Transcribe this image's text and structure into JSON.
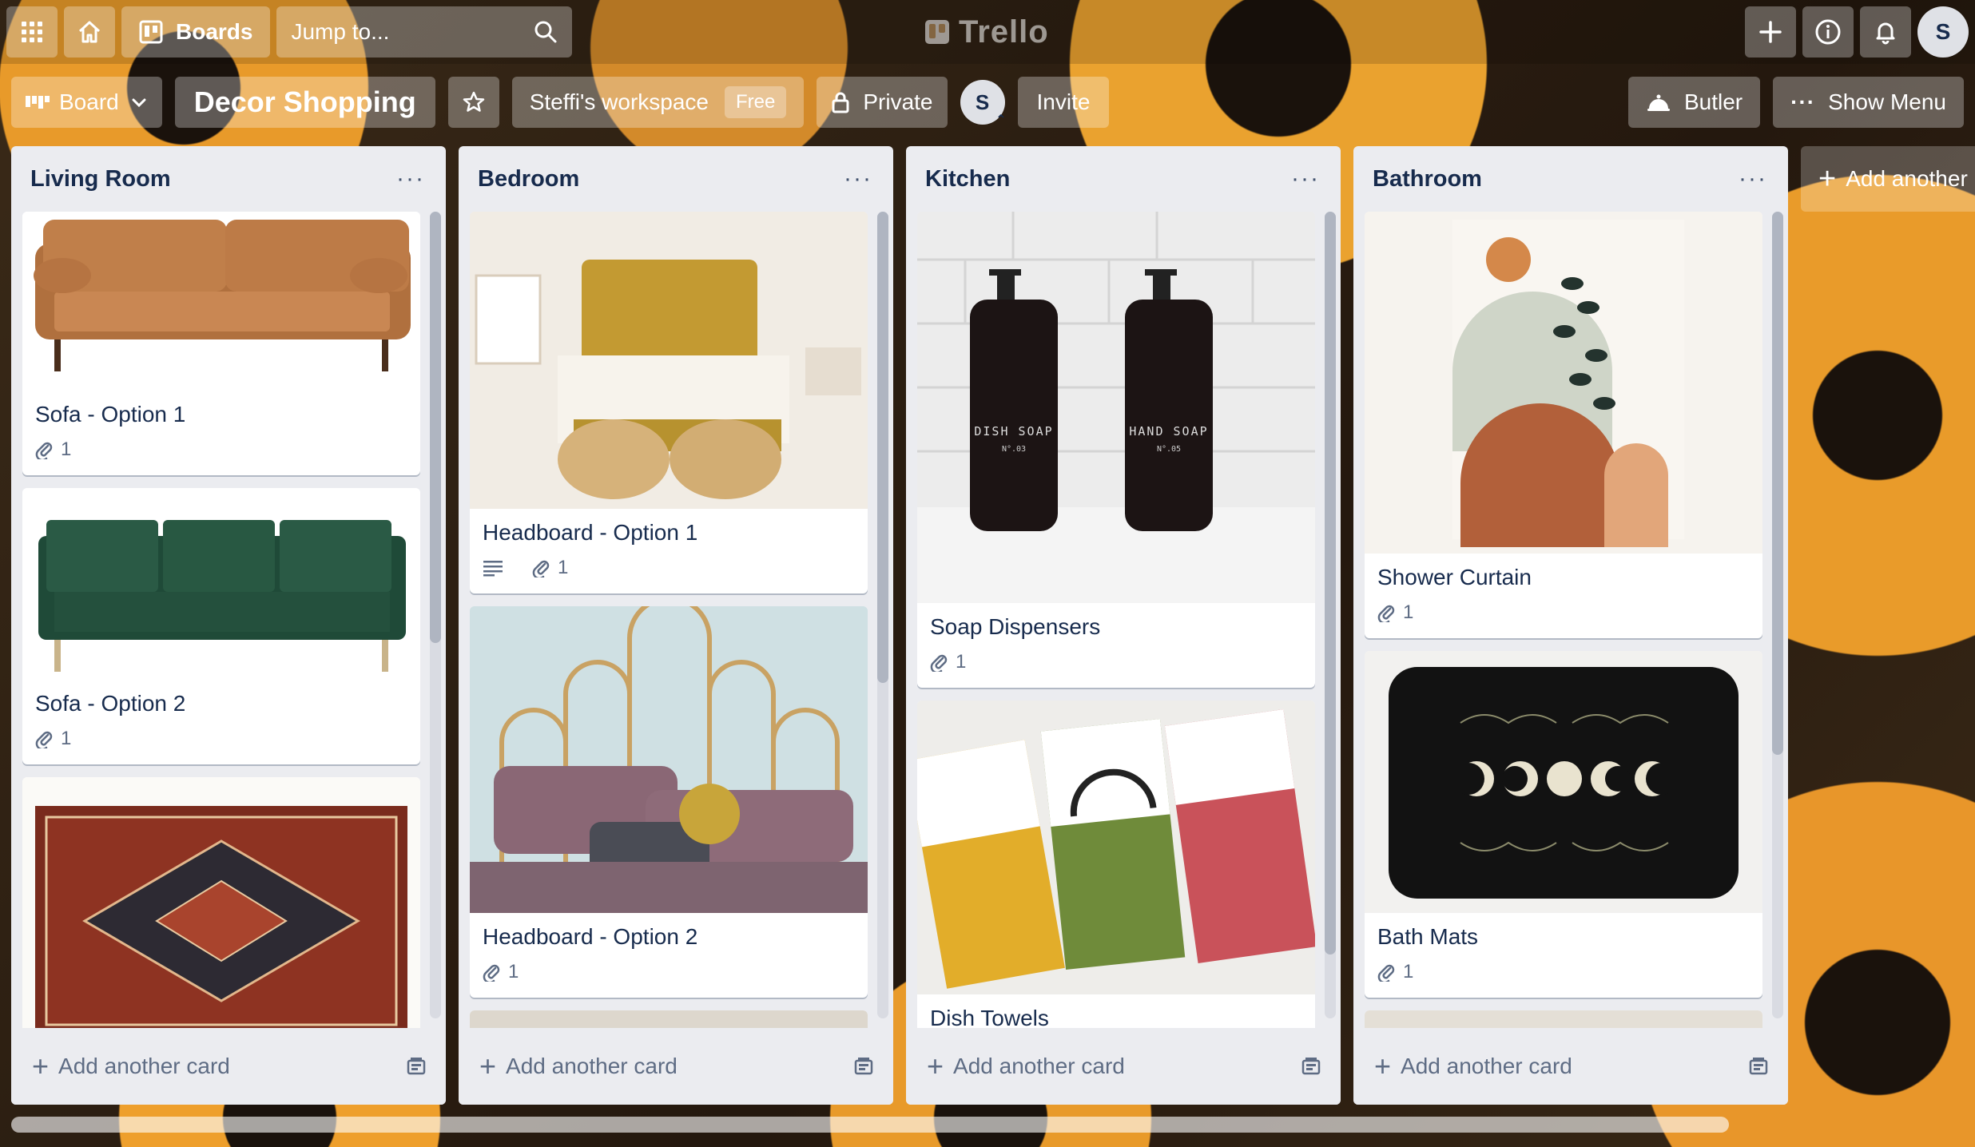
{
  "header": {
    "boards_label": "Boards",
    "search_placeholder": "Jump to...",
    "logo_text": "Trello",
    "user_initial": "S"
  },
  "board": {
    "view_label": "Board",
    "title": "Decor Shopping",
    "workspace": "Steffi's workspace",
    "workspace_badge": "Free",
    "visibility": "Private",
    "member_initial": "S",
    "invite_label": "Invite",
    "butler_label": "Butler",
    "show_menu_label": "Show Menu",
    "add_list_label": "Add another list"
  },
  "lists": [
    {
      "title": "Living Room",
      "add_card_label": "Add another card",
      "cards": [
        {
          "title": "Sofa - Option 1",
          "attachments": "1"
        },
        {
          "title": "Sofa - Option 2",
          "attachments": "1"
        }
      ]
    },
    {
      "title": "Bedroom",
      "add_card_label": "Add another card",
      "cards": [
        {
          "title": "Headboard - Option 1",
          "attachments": "1"
        },
        {
          "title": "Headboard - Option 2",
          "attachments": "1"
        }
      ]
    },
    {
      "title": "Kitchen",
      "add_card_label": "Add another card",
      "cards": [
        {
          "title": "Soap Dispensers",
          "attachments": "1",
          "cover_text_1": "DISH SOAP",
          "cover_sub_1": "N°.03",
          "cover_text_2": "HAND SOAP",
          "cover_sub_2": "N°.05"
        },
        {
          "title": "Dish Towels"
        }
      ]
    },
    {
      "title": "Bathroom",
      "add_card_label": "Add another card",
      "cards": [
        {
          "title": "Shower Curtain",
          "attachments": "1"
        },
        {
          "title": "Bath Mats",
          "attachments": "1"
        }
      ]
    }
  ],
  "colors": {
    "list_bg": "#ebecf0",
    "text_primary": "#172b4d",
    "text_secondary": "#5e6c84"
  }
}
